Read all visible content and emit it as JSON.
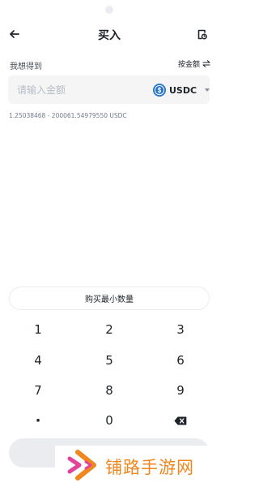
{
  "header": {
    "title": "买入"
  },
  "form": {
    "want_label": "我想得到",
    "toggle_label": "按金额",
    "amount_placeholder": "请输入金额",
    "amount_value": "",
    "currency": "USDC",
    "range": "1.25038468 - 200061.54979550 USDC",
    "min_quantity_label": "购买最小数量"
  },
  "keypad": {
    "row1": [
      "1",
      "2",
      "3"
    ],
    "row2": [
      "4",
      "5",
      "6"
    ],
    "row3": [
      "7",
      "8",
      "9"
    ],
    "row4": [
      "·",
      "0"
    ],
    "backspace_icon": "backspace-icon"
  },
  "watermark": {
    "text": "铺路手游网"
  },
  "colors": {
    "usdc": "#2775ca",
    "watermark": "#f0861e",
    "button_disabled": "#eaecef"
  }
}
